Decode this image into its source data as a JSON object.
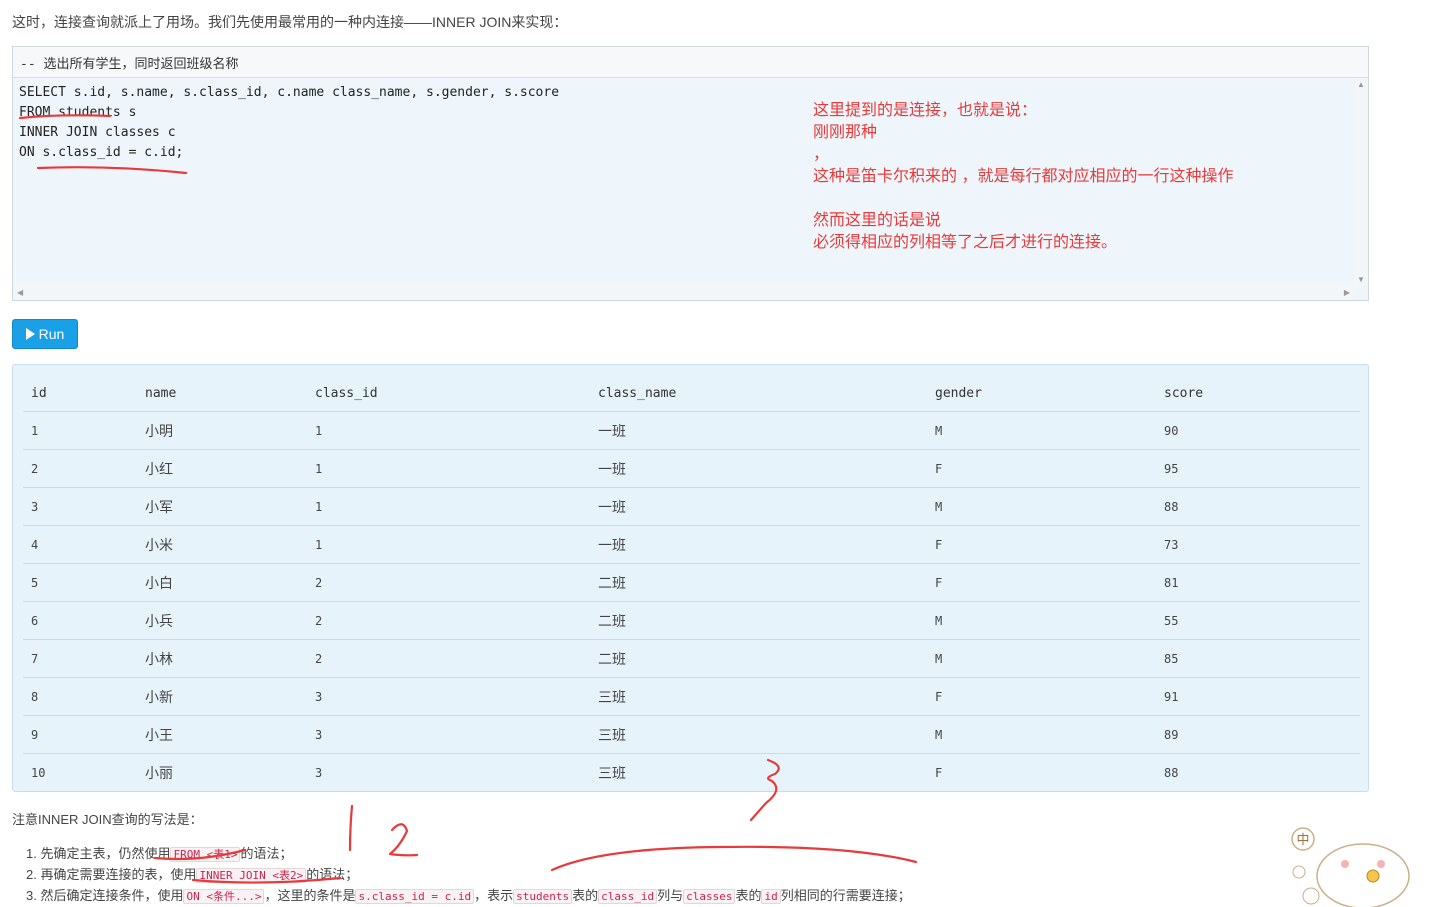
{
  "intro": "这时，连接查询就派上了用场。我们先使用最常用的一种内连接——INNER JOIN来实现：",
  "editor": {
    "comment": "-- 选出所有学生，同时返回班级名称",
    "lines": [
      "SELECT s.id, s.name, s.class_id, c.name class_name, s.gender, s.score",
      "FROM students s",
      "INNER JOIN classes c",
      "ON s.class_id = c.id;"
    ]
  },
  "annotation": {
    "lines": [
      "这里提到的是连接，也就是说：",
      "刚刚那种",
      "，",
      "这种是笛卡尔积来的 ，就是每行都对应相应的一行这种操作",
      "",
      "然而这里的话是说",
      "必须得相应的列相等了之后才进行的连接。"
    ],
    "handwritten": [
      "1",
      "2",
      "3"
    ],
    "color": "#e83a3a"
  },
  "run_button": {
    "label": "Run"
  },
  "result": {
    "columns": [
      "id",
      "name",
      "class_id",
      "class_name",
      "gender",
      "score"
    ],
    "rows": [
      [
        "1",
        "小明",
        "1",
        "一班",
        "M",
        "90"
      ],
      [
        "2",
        "小红",
        "1",
        "一班",
        "F",
        "95"
      ],
      [
        "3",
        "小军",
        "1",
        "一班",
        "M",
        "88"
      ],
      [
        "4",
        "小米",
        "1",
        "一班",
        "F",
        "73"
      ],
      [
        "5",
        "小白",
        "2",
        "二班",
        "F",
        "81"
      ],
      [
        "6",
        "小兵",
        "2",
        "二班",
        "M",
        "55"
      ],
      [
        "7",
        "小林",
        "2",
        "二班",
        "M",
        "85"
      ],
      [
        "8",
        "小新",
        "3",
        "三班",
        "F",
        "91"
      ],
      [
        "9",
        "小王",
        "3",
        "三班",
        "M",
        "89"
      ],
      [
        "10",
        "小丽",
        "3",
        "三班",
        "F",
        "88"
      ]
    ]
  },
  "outro": "注意INNER JOIN查询的写法是：",
  "steps": [
    {
      "num": "1.",
      "pre": "先确定主表，仍然使用",
      "code": "FROM <表1>",
      "post": "的语法；"
    },
    {
      "num": "2.",
      "pre": "再确定需要连接的表，使用",
      "code": "INNER JOIN <表2>",
      "post": "的语法；"
    },
    {
      "num": "3.",
      "pre": "然后确定连接条件，使用",
      "code": "ON <条件...>",
      "mid1": "，这里的条件是",
      "code2": "s.class_id = c.id",
      "mid2": "，表示",
      "code3": "students",
      "mid3": "表的",
      "code4": "class_id",
      "mid4": "列与",
      "code5": "classes",
      "mid5": "表的",
      "code6": "id",
      "post": "列相同的行需要连接；"
    }
  ],
  "mascot": {
    "badge": "中"
  }
}
